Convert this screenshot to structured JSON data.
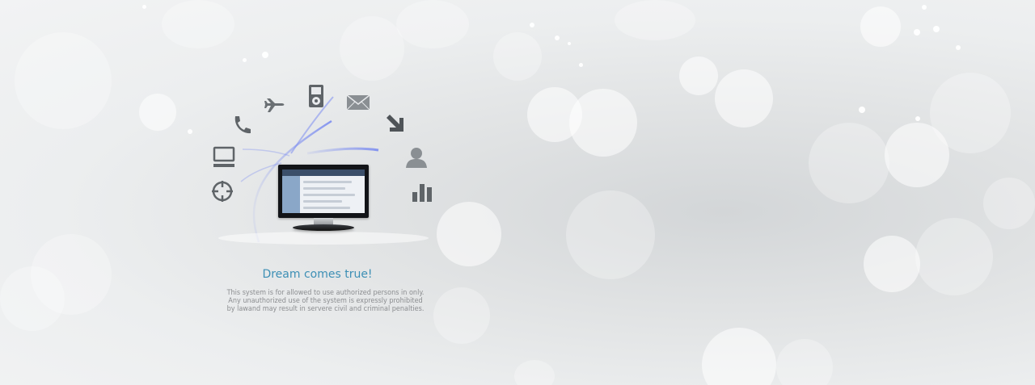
{
  "hero": {
    "headline": "Dream comes true!",
    "notice": {
      "line1": "This system is for allowed to use authorized persons in only.",
      "line2": "Any unauthorized use of the system is expressly prohibited",
      "line3": "by lawand may result in servere civil and criminal penalties."
    },
    "icons": [
      "monitor-icon",
      "phone-icon",
      "airplane-icon",
      "media-player-icon",
      "envelope-icon",
      "arrow-down-right-icon",
      "user-icon",
      "bar-chart-icon",
      "crosshair-icon"
    ]
  },
  "colors": {
    "headline": "#3d8fb5",
    "notice": "#8b8d90",
    "icon": "#5f6468",
    "arc": "#7b8cf0"
  }
}
